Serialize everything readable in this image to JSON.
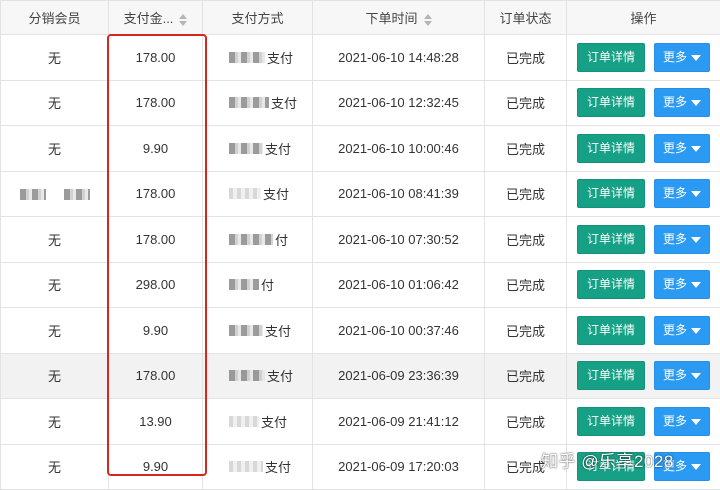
{
  "columns": {
    "member": "分销会员",
    "amount": "支付金...",
    "method": "支付方式",
    "time": "下单时间",
    "status": "订单状态",
    "actions": "操作"
  },
  "buttons": {
    "detail": "订单详情",
    "more": "更多"
  },
  "rows": [
    {
      "member": "无",
      "amount": "178.00",
      "method": "支付",
      "time": "2021-06-10 14:48:28",
      "status": "已完成"
    },
    {
      "member": "无",
      "amount": "178.00",
      "method": "支付",
      "time": "2021-06-10 12:32:45",
      "status": "已完成"
    },
    {
      "member": "无",
      "amount": "9.90",
      "method": "支付",
      "time": "2021-06-10 10:00:46",
      "status": "已完成"
    },
    {
      "member": "",
      "amount": "178.00",
      "method": "支付",
      "time": "2021-06-10 08:41:39",
      "status": "已完成"
    },
    {
      "member": "无",
      "amount": "178.00",
      "method": "付",
      "time": "2021-06-10 07:30:52",
      "status": "已完成"
    },
    {
      "member": "无",
      "amount": "298.00",
      "method": "付",
      "time": "2021-06-10 01:06:42",
      "status": "已完成"
    },
    {
      "member": "无",
      "amount": "9.90",
      "method": "支付",
      "time": "2021-06-10 00:37:46",
      "status": "已完成"
    },
    {
      "member": "无",
      "amount": "178.00",
      "method": "支付",
      "time": "2021-06-09 23:36:39",
      "status": "已完成"
    },
    {
      "member": "无",
      "amount": "13.90",
      "method": "支付",
      "time": "2021-06-09 21:41:12",
      "status": "已完成"
    },
    {
      "member": "无",
      "amount": "9.90",
      "method": "支付",
      "time": "2021-06-09 17:20:03",
      "status": "已完成"
    }
  ],
  "watermark": "知乎 @乐享2028",
  "colors": {
    "detail_button": "#16a085",
    "more_button": "#2b9af3",
    "highlight": "#d9261c"
  }
}
